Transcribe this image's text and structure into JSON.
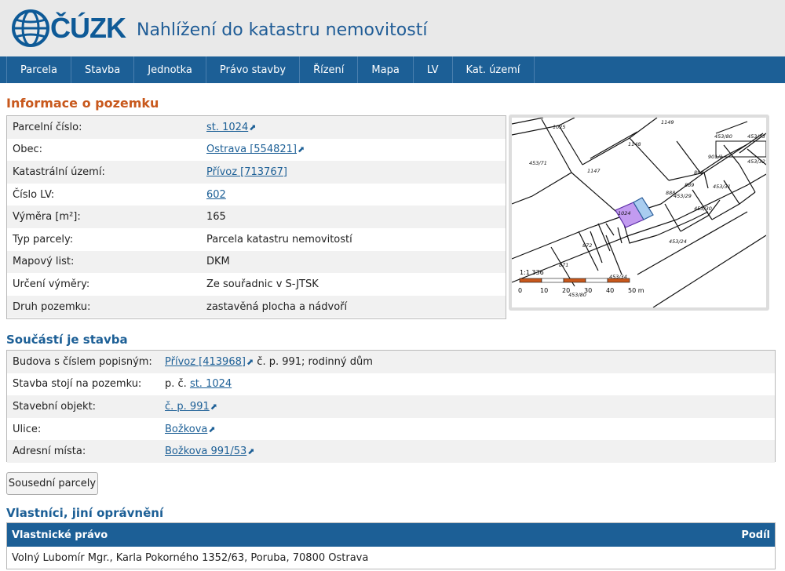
{
  "header": {
    "logo_text": "ČÚZK",
    "site_title": "Nahlížení do katastru nemovitostí"
  },
  "nav": [
    "Parcela",
    "Stavba",
    "Jednotka",
    "Právo stavby",
    "Řízení",
    "Mapa",
    "LV",
    "Kat. území"
  ],
  "parcel_info": {
    "heading": "Informace o pozemku",
    "rows": [
      {
        "label": "Parcelní číslo:",
        "value": "st. 1024",
        "link": true,
        "ext": true
      },
      {
        "label": "Obec:",
        "value": "Ostrava [554821]",
        "link": true,
        "ext": true
      },
      {
        "label": "Katastrální území:",
        "value": "Přívoz [713767]",
        "link": true,
        "ext": false
      },
      {
        "label": "Číslo LV:",
        "value": "602",
        "link": true,
        "ext": false
      },
      {
        "label": "Výměra [m²]:",
        "value": "165",
        "link": false,
        "ext": false
      },
      {
        "label": "Typ parcely:",
        "value": "Parcela katastru nemovitostí",
        "link": false,
        "ext": false
      },
      {
        "label": "Mapový list:",
        "value": "DKM",
        "link": false,
        "ext": false
      },
      {
        "label": "Určení výměry:",
        "value": "Ze souřadnic v S-JTSK",
        "link": false,
        "ext": false
      },
      {
        "label": "Druh pozemku:",
        "value": "zastavěná plocha a nádvoří",
        "link": false,
        "ext": false
      }
    ]
  },
  "map": {
    "scale_text": "1:1 336",
    "scale_ticks": [
      "0",
      "10",
      "20",
      "30",
      "40",
      "50 m"
    ],
    "labels": [
      "1025",
      "1149",
      "1148",
      "1147",
      "453/71",
      "453/80",
      "453/33",
      "901/1",
      "453/32",
      "888",
      "889",
      "890",
      "453/31",
      "453/30",
      "453/29",
      "453/24",
      "1024",
      "872",
      "871",
      "453/34",
      "453/80"
    ]
  },
  "building": {
    "heading": "Součástí je stavba",
    "rows": [
      {
        "label": "Budova s číslem popisným:",
        "parts": [
          {
            "text": "Přívoz [413968]",
            "link": true,
            "ext": true
          },
          {
            "text": " č. p. 991; rodinný dům",
            "link": false,
            "ext": false
          }
        ]
      },
      {
        "label": "Stavba stojí na pozemku:",
        "parts": [
          {
            "text": "p. č. ",
            "link": false,
            "ext": false
          },
          {
            "text": "st. 1024",
            "link": true,
            "ext": false
          }
        ]
      },
      {
        "label": "Stavební objekt:",
        "parts": [
          {
            "text": "č. p. 991",
            "link": true,
            "ext": true
          }
        ]
      },
      {
        "label": "Ulice:",
        "parts": [
          {
            "text": "Božkova",
            "link": true,
            "ext": true
          }
        ]
      },
      {
        "label": "Adresní místa:",
        "parts": [
          {
            "text": "Božkova 991/53",
            "link": true,
            "ext": true
          }
        ]
      }
    ]
  },
  "neighbors_button": "Sousední parcely",
  "owners": {
    "heading": "Vlastníci, jiní oprávnění",
    "col_left": "Vlastnické právo",
    "col_right": "Podíl",
    "rows": [
      "Volný Lubomír Mgr., Karla Pokorného 1352/63, Poruba, 70800 Ostrava"
    ]
  },
  "colors": {
    "brand": "#1c5f96",
    "heading_orange": "#c8581c",
    "parcel_highlight": "#c29bf0",
    "building_highlight": "#a9cdf0"
  }
}
